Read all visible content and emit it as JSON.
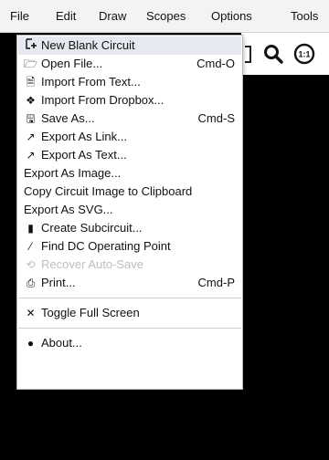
{
  "menubar": {
    "items": [
      "File",
      "Edit",
      "Draw",
      "Scopes",
      "Options",
      "Tools"
    ]
  },
  "toolbar": {
    "icons": [
      "undo-icon",
      "search-icon",
      "zoom-1-1-icon"
    ],
    "zoom_label": "1:1"
  },
  "file_menu": {
    "items": [
      {
        "label": "New Blank Circuit",
        "icon": "new-circuit-icon",
        "glyph": "+",
        "shortcut": ""
      },
      {
        "label": "Open File...",
        "icon": "folder-open-icon",
        "glyph": "🗁",
        "shortcut": "Cmd-O"
      },
      {
        "label": "Import From Text...",
        "icon": "text-file-icon",
        "glyph": "🗎",
        "shortcut": ""
      },
      {
        "label": "Import From Dropbox...",
        "icon": "dropbox-icon",
        "glyph": "❖",
        "shortcut": ""
      },
      {
        "label": "Save As...",
        "icon": "save-icon",
        "glyph": "🖫",
        "shortcut": "Cmd-S"
      },
      {
        "label": "Export As Link...",
        "icon": "export-icon",
        "glyph": "↗",
        "shortcut": ""
      },
      {
        "label": "Export As Text...",
        "icon": "export-icon",
        "glyph": "↗",
        "shortcut": ""
      },
      {
        "label": "Export As Image...",
        "icon": "",
        "glyph": "",
        "shortcut": ""
      },
      {
        "label": "Copy Circuit Image to Clipboard",
        "icon": "",
        "glyph": "",
        "shortcut": ""
      },
      {
        "label": "Export As SVG...",
        "icon": "",
        "glyph": "",
        "shortcut": ""
      },
      {
        "label": "Create Subcircuit...",
        "icon": "chip-icon",
        "glyph": "▮",
        "shortcut": ""
      },
      {
        "label": "Find DC Operating Point",
        "icon": "magic-wand-icon",
        "glyph": "⁄",
        "shortcut": ""
      },
      {
        "label": "Recover Auto-Save",
        "icon": "history-icon",
        "glyph": "⟲",
        "shortcut": ""
      },
      {
        "label": "Print...",
        "icon": "print-icon",
        "glyph": "⎙",
        "shortcut": "Cmd-P"
      },
      {
        "label": "Toggle Full Screen",
        "icon": "fullscreen-icon",
        "glyph": "✕",
        "shortcut": ""
      },
      {
        "label": "About...",
        "icon": "info-icon",
        "glyph": "●",
        "shortcut": ""
      }
    ]
  }
}
